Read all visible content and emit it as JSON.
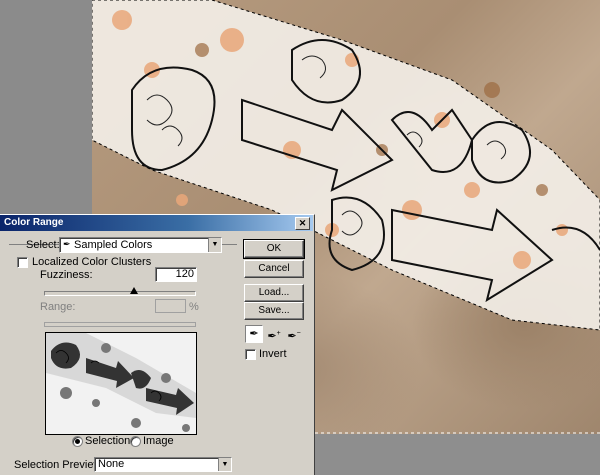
{
  "dialog": {
    "title": "Color Range",
    "select_label": "Select:",
    "select_value": "Sampled Colors",
    "localized_label": "Localized Color Clusters",
    "localized_checked": false,
    "fuzziness_label": "Fuzziness:",
    "fuzziness_value": "120",
    "fuzziness_fraction": 0.6,
    "range_label": "Range:",
    "range_unit": "%",
    "range_value": "",
    "selection_label": "Selection",
    "image_label": "Image",
    "selected_view": "Selection",
    "preview_label": "Selection Preview:",
    "preview_value": "None",
    "invert_label": "Invert",
    "invert_checked": false
  },
  "buttons": {
    "ok": "OK",
    "cancel": "Cancel",
    "load": "Load...",
    "save": "Save..."
  },
  "eyedroppers": [
    "eyedropper-icon",
    "eyedropper-plus-icon",
    "eyedropper-minus-icon"
  ],
  "colors": {
    "titlebar_start": "#0a246a",
    "titlebar_end": "#a6caf0",
    "dialog_bg": "#d4d0c8",
    "canvas_tan": "#b79c80"
  }
}
